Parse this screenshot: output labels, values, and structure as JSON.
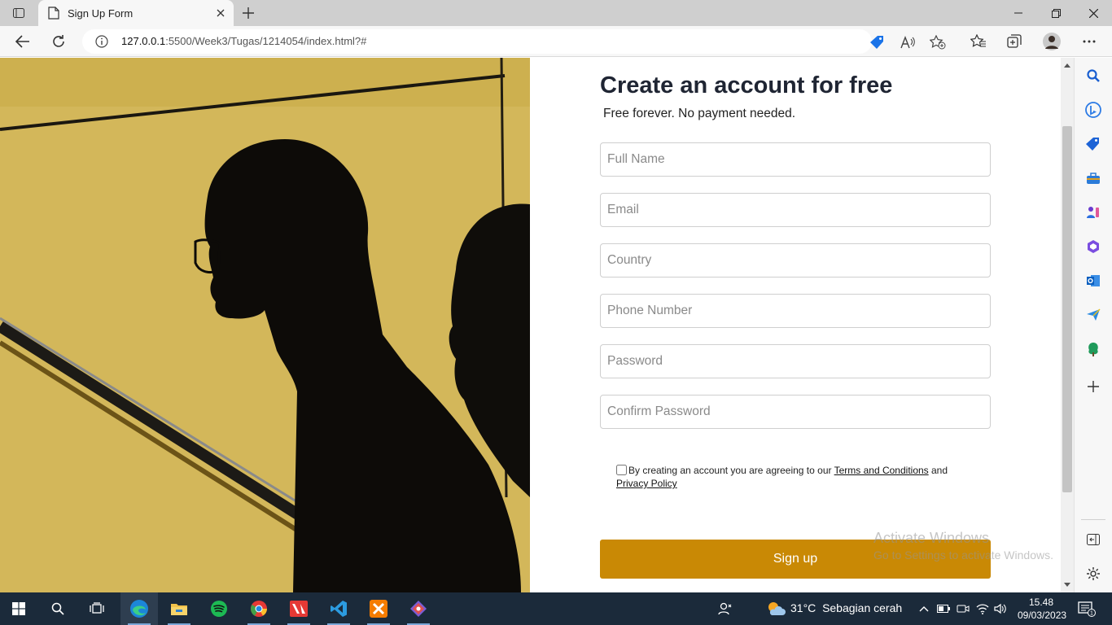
{
  "browser": {
    "tab_title": "Sign Up Form",
    "url_host": "127.0.0.1",
    "url_path": ":5500/Week3/Tugas/1214054/index.html?#"
  },
  "form": {
    "title": "Create an account for free",
    "subtitle": "Free forever. No payment needed.",
    "fields": {
      "full_name": "Full Name",
      "email": "Email",
      "country": "Country",
      "phone": "Phone Number",
      "password": "Password",
      "confirm_password": "Confirm Password"
    },
    "agree_prefix": "By creating an account you are agreeing to our ",
    "terms_link": "Terms and Conditions",
    "agree_mid": " and",
    "privacy_link": "Privacy Policy",
    "agree_checked": false,
    "signup_label": "Sign up"
  },
  "watermark": {
    "line1": "Activate Windows",
    "line2": "Go to Settings to activate Windows."
  },
  "taskbar": {
    "weather_temp": "31°C",
    "weather_desc": "Sebagian cerah",
    "time": "15.48",
    "date": "09/03/2023",
    "notification_count": "1"
  },
  "colors": {
    "accent_button": "#c98905",
    "photo_background": "#d3b75a",
    "taskbar": "#1b2a3a"
  }
}
